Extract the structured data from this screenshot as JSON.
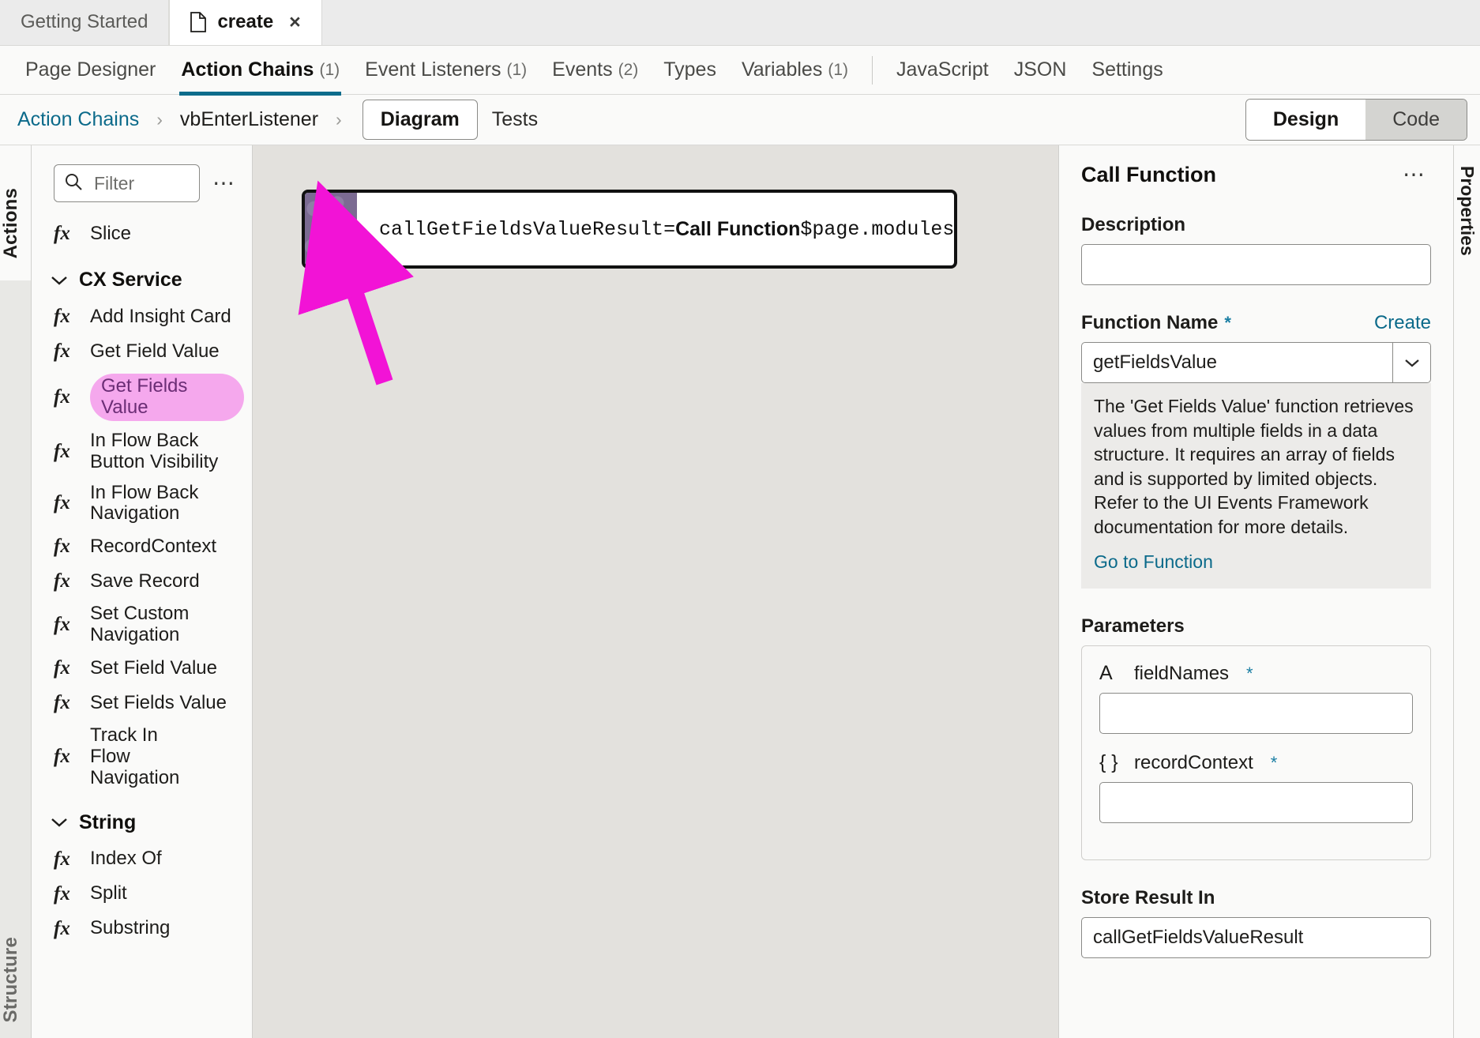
{
  "window_tabs": [
    {
      "label": "Getting Started",
      "active": false,
      "has_icon": false,
      "closable": false
    },
    {
      "label": "create",
      "active": true,
      "has_icon": true,
      "closable": true,
      "close_glyph": "×"
    }
  ],
  "sub_tabs": [
    {
      "label": "Page Designer",
      "count": "",
      "active": false
    },
    {
      "label": "Action Chains",
      "count": "(1)",
      "active": true
    },
    {
      "label": "Event Listeners",
      "count": "(1)",
      "active": false
    },
    {
      "label": "Events",
      "count": "(2)",
      "active": false
    },
    {
      "label": "Types",
      "count": "",
      "active": false
    },
    {
      "label": "Variables",
      "count": "(1)",
      "active": false
    },
    {
      "label": "JavaScript",
      "count": "",
      "active": false,
      "after_divider": true
    },
    {
      "label": "JSON",
      "count": "",
      "active": false
    },
    {
      "label": "Settings",
      "count": "",
      "active": false
    }
  ],
  "breadcrumb": {
    "root_link": "Action Chains",
    "separator": "›",
    "chain_name": "vbEnterListener",
    "view_tabs": [
      {
        "label": "Diagram",
        "active": true
      },
      {
        "label": "Tests",
        "active": false
      }
    ]
  },
  "mode_toggle": {
    "design_label": "Design",
    "code_label": "Code",
    "selected": "Design"
  },
  "rails": {
    "left_top": "Actions",
    "left_bottom": "Structure",
    "right": "Properties"
  },
  "palette": {
    "filter_placeholder": "Filter",
    "filter_value": "",
    "search_icon": "search-icon",
    "overflow_icon": "kebab-icon",
    "top_items": [
      {
        "label": "Slice",
        "icon": "fx",
        "highlighted": false
      }
    ],
    "groups": [
      {
        "name": "CX Service",
        "expanded": true,
        "items": [
          {
            "label": "Add Insight Card",
            "icon": "fx",
            "highlighted": false
          },
          {
            "label": "Get Field Value",
            "icon": "fx",
            "highlighted": false
          },
          {
            "label": "Get Fields Value",
            "icon": "fx",
            "highlighted": true
          },
          {
            "label": "In Flow Back Button Visibility",
            "icon": "fx",
            "highlighted": false
          },
          {
            "label": "In Flow Back Navigation",
            "icon": "fx",
            "highlighted": false
          },
          {
            "label": "RecordContext",
            "icon": "fx",
            "highlighted": false
          },
          {
            "label": "Save Record",
            "icon": "fx",
            "highlighted": false
          },
          {
            "label": "Set Custom Navigation",
            "icon": "fx",
            "highlighted": false
          },
          {
            "label": "Set Field Value",
            "icon": "fx",
            "highlighted": false
          },
          {
            "label": "Set Fields Value",
            "icon": "fx",
            "highlighted": false
          },
          {
            "label": "Track In Flow Navigation",
            "icon": "fx",
            "highlighted": false
          }
        ]
      },
      {
        "name": "String",
        "expanded": true,
        "items": [
          {
            "label": "Index Of",
            "icon": "fx",
            "highlighted": false
          },
          {
            "label": "Split",
            "icon": "fx",
            "highlighted": false
          },
          {
            "label": "Substring",
            "icon": "fx",
            "highlighted": false
          }
        ]
      }
    ]
  },
  "canvas": {
    "node": {
      "icon": "js-call-function-icon",
      "icon_label": "JS",
      "result_var": "callGetFieldsValueResult",
      "equals": " = ",
      "action_label": "Call Function",
      "target": " $page.modules"
    },
    "annotation": {
      "type": "arrow",
      "color": "#F213D6",
      "points_from": "Get Fields Value palette item",
      "points_to": "Call Function node"
    }
  },
  "properties": {
    "title": "Call Function",
    "overflow_icon": "kebab-icon",
    "description": {
      "label": "Description",
      "value": "",
      "placeholder": ""
    },
    "function_name": {
      "label": "Function Name",
      "required_marker": "*",
      "create_link": "Create",
      "value": "getFieldsValue",
      "caret_icon": "chevron-down-icon",
      "help_text": "The 'Get Fields Value' function retrieves values from multiple fields in a data structure. It requires an array of fields and is supported by limited objects. Refer to the UI Events Framework documentation for more details.",
      "help_link": "Go to Function"
    },
    "parameters": {
      "label": "Parameters",
      "items": [
        {
          "type_icon": "A",
          "name": "fieldNames",
          "required_marker": "*",
          "value": ""
        },
        {
          "type_icon": "{ }",
          "name": "recordContext",
          "required_marker": "*",
          "value": ""
        }
      ]
    },
    "store_result": {
      "label": "Store Result In",
      "value": "callGetFieldsValueResult"
    }
  },
  "colors": {
    "accent": "#0b6a8a",
    "tab_indicator": "#0c6c8c",
    "highlight_pill_bg": "#f5a8ed",
    "highlight_pill_fg": "#6b2d75",
    "arrow": "#F213D6",
    "node_icon_bg": "#7b6b92",
    "canvas_bg": "#e3e1dd"
  }
}
